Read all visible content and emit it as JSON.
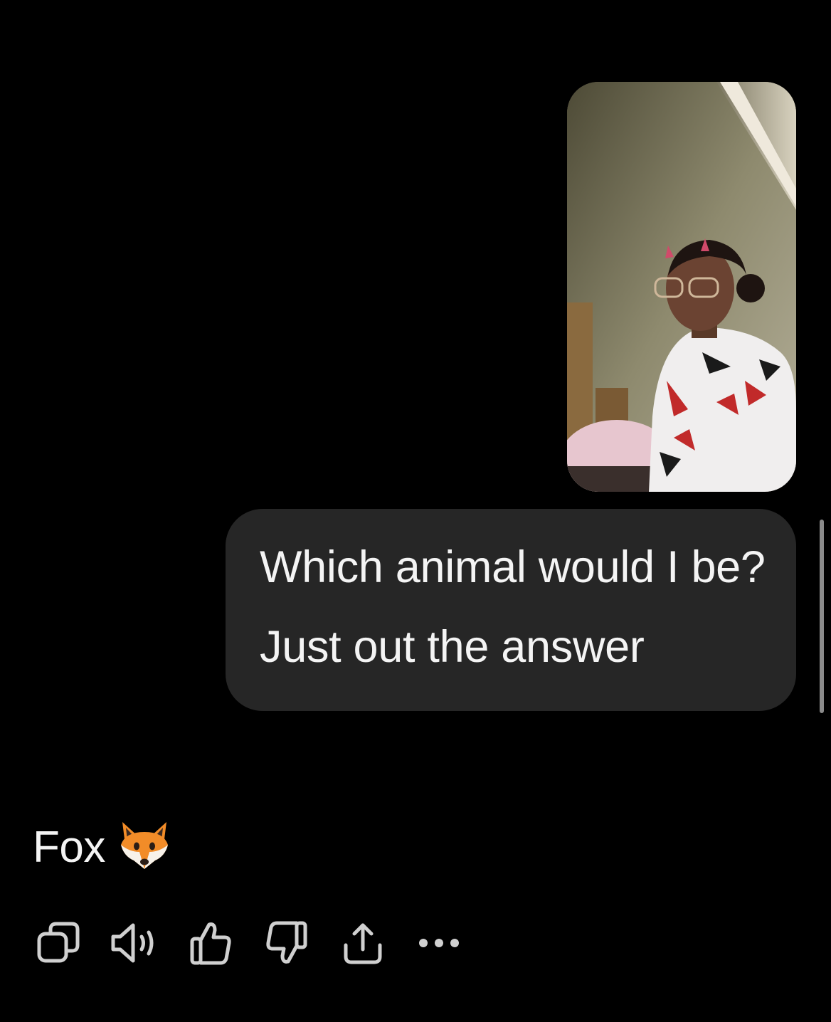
{
  "conversation": {
    "user_message": {
      "attachment": {
        "type": "image",
        "alt": "Selfie photo attachment"
      },
      "text": "Which animal would I be? Just out the answer"
    },
    "assistant_message": {
      "text": "Fox",
      "emoji_icon": "fox-face-icon"
    }
  },
  "actions": [
    {
      "name": "copy",
      "icon": "copy-icon"
    },
    {
      "name": "read-aloud",
      "icon": "speaker-icon"
    },
    {
      "name": "good-response",
      "icon": "thumbs-up-icon"
    },
    {
      "name": "bad-response",
      "icon": "thumbs-down-icon"
    },
    {
      "name": "share",
      "icon": "share-icon"
    },
    {
      "name": "more",
      "icon": "more-icon"
    }
  ],
  "colors": {
    "background": "#000000",
    "bubble": "#262626",
    "text": "#f4f4f4",
    "icon": "#d0d0d0"
  }
}
